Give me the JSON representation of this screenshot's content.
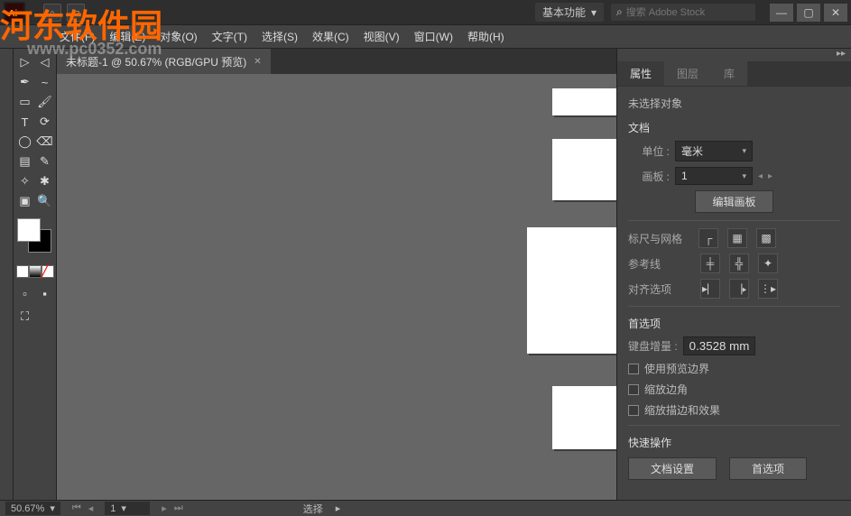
{
  "watermark": {
    "line1": "河东软件园",
    "line2": "www.pc0352.com"
  },
  "titlebar": {
    "workspace": "基本功能",
    "search_placeholder": "搜索 Adobe Stock"
  },
  "menu": {
    "file": "文件(F)",
    "edit": "编辑(E)",
    "object": "对象(O)",
    "text": "文字(T)",
    "select": "选择(S)",
    "effect": "效果(C)",
    "view": "视图(V)",
    "window": "窗口(W)",
    "help": "帮助(H)"
  },
  "document": {
    "tab_title": "未标题-1 @ 50.67% (RGB/GPU 预览)"
  },
  "panels": {
    "tabs": {
      "properties": "属性",
      "layers": "图层",
      "libraries": "库"
    },
    "no_selection": "未选择对象",
    "section_document": "文档",
    "unit_label": "单位 :",
    "unit_value": "毫米",
    "artboard_label": "画板 :",
    "artboard_value": "1",
    "edit_artboard_btn": "编辑画板",
    "section_rulers": "标尺与网格",
    "section_guides": "参考线",
    "section_align": "对齐选项",
    "section_prefs": "首选项",
    "kb_increment_label": "键盘增量 :",
    "kb_increment_value": "0.3528 mm",
    "cb_preview": "使用预览边界",
    "cb_scale_corners": "缩放边角",
    "cb_scale_strokes": "缩放描边和效果",
    "section_quick": "快速操作",
    "btn_doc_setup": "文档设置",
    "btn_prefs": "首选项"
  },
  "status": {
    "zoom": "50.67%",
    "artboard": "1",
    "mode": "选择"
  }
}
